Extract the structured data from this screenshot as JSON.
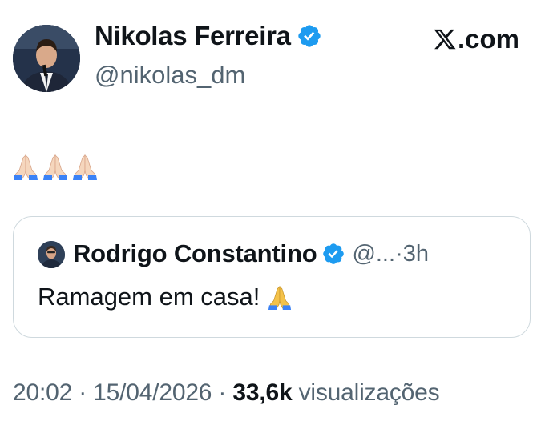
{
  "author": {
    "name": "Nikolas Ferreira",
    "handle": "@nikolas_dm",
    "verified": true
  },
  "brand": {
    "label": ".com"
  },
  "tweet": {
    "emojis": [
      "folded-hands-emoji",
      "folded-hands-emoji",
      "folded-hands-emoji"
    ]
  },
  "quoted": {
    "name": "Rodrigo Constantino",
    "handle": "@...",
    "separator": "·",
    "time": "3h",
    "text": "Ramagem em casa!",
    "emoji": "folded-hands-emoji"
  },
  "footer": {
    "time": "20:02",
    "sep1": " · ",
    "date": "15/04/2026",
    "sep2": " · ",
    "views": "33,6k",
    "views_label": " visualizações"
  },
  "colors": {
    "text": "#0f1419",
    "muted": "#536471",
    "verified": "#1d9bf0",
    "border": "#cfd9de"
  }
}
